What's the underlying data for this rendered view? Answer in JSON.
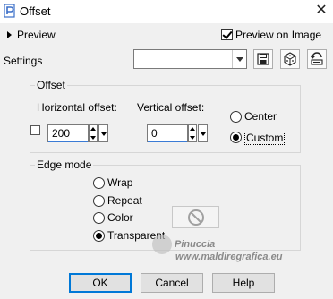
{
  "window": {
    "title": "Offset",
    "close_glyph": "✕"
  },
  "preview": {
    "label": "Preview",
    "preview_on_image_label": "Preview on Image",
    "preview_on_image_checked": true
  },
  "settings": {
    "label": "Settings",
    "combo_value": "",
    "buttons": [
      "save-icon",
      "randomize-icon",
      "reset-icon"
    ]
  },
  "offset": {
    "group_title": "Offset",
    "horizontal_label": "Horizontal offset:",
    "horizontal_value": "200",
    "vertical_label": "Vertical offset:",
    "vertical_value": "0",
    "center_label": "Center",
    "custom_label": "Custom",
    "selected": "Custom"
  },
  "edge_mode": {
    "group_title": "Edge mode",
    "options": [
      "Wrap",
      "Repeat",
      "Color",
      "Transparent"
    ],
    "selected": "Transparent"
  },
  "watermark": {
    "line1": "Pinuccia",
    "line2": "www.maldiregrafica.eu"
  },
  "buttons": {
    "ok": "OK",
    "cancel": "Cancel",
    "help": "Help"
  },
  "colors": {
    "accent": "#0078d7",
    "dialog_bg": "#f0f0f0"
  }
}
